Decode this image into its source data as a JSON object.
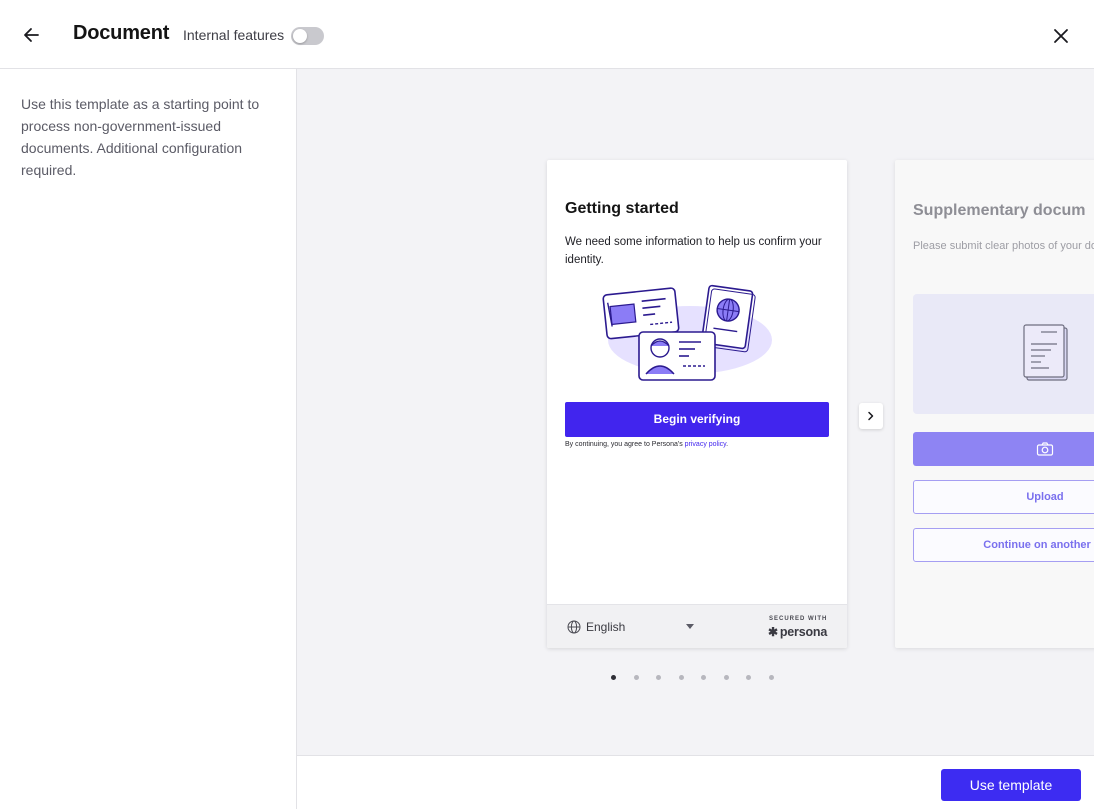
{
  "header": {
    "title": "Document",
    "internal_features_label": "Internal features",
    "internal_features_enabled": false,
    "back_icon": "arrow-left-icon",
    "close_icon": "close-icon"
  },
  "sidebar": {
    "description": "Use this template as a starting point to process non-government-issued documents. Additional configuration required."
  },
  "preview": {
    "screen1": {
      "title": "Getting started",
      "text": "We need some information to help us confirm your identity.",
      "button_label": "Begin verifying",
      "consent_text": "By continuing, you agree to Persona's",
      "consent_link": "privacy policy",
      "consent_end": ".",
      "language": "English",
      "secured_with": "SECURED WITH",
      "brand": "persona"
    },
    "screen2": {
      "title": "Supplementary docum",
      "text": "Please submit clear photos of your document.",
      "upload_label": "Upload",
      "continue_label": "Continue on another de"
    },
    "pagination": {
      "total": 8,
      "active": 0
    }
  },
  "footer": {
    "use_template_label": "Use template"
  },
  "colors": {
    "accent": "#4125ee",
    "accent_light": "#8e84f3"
  }
}
